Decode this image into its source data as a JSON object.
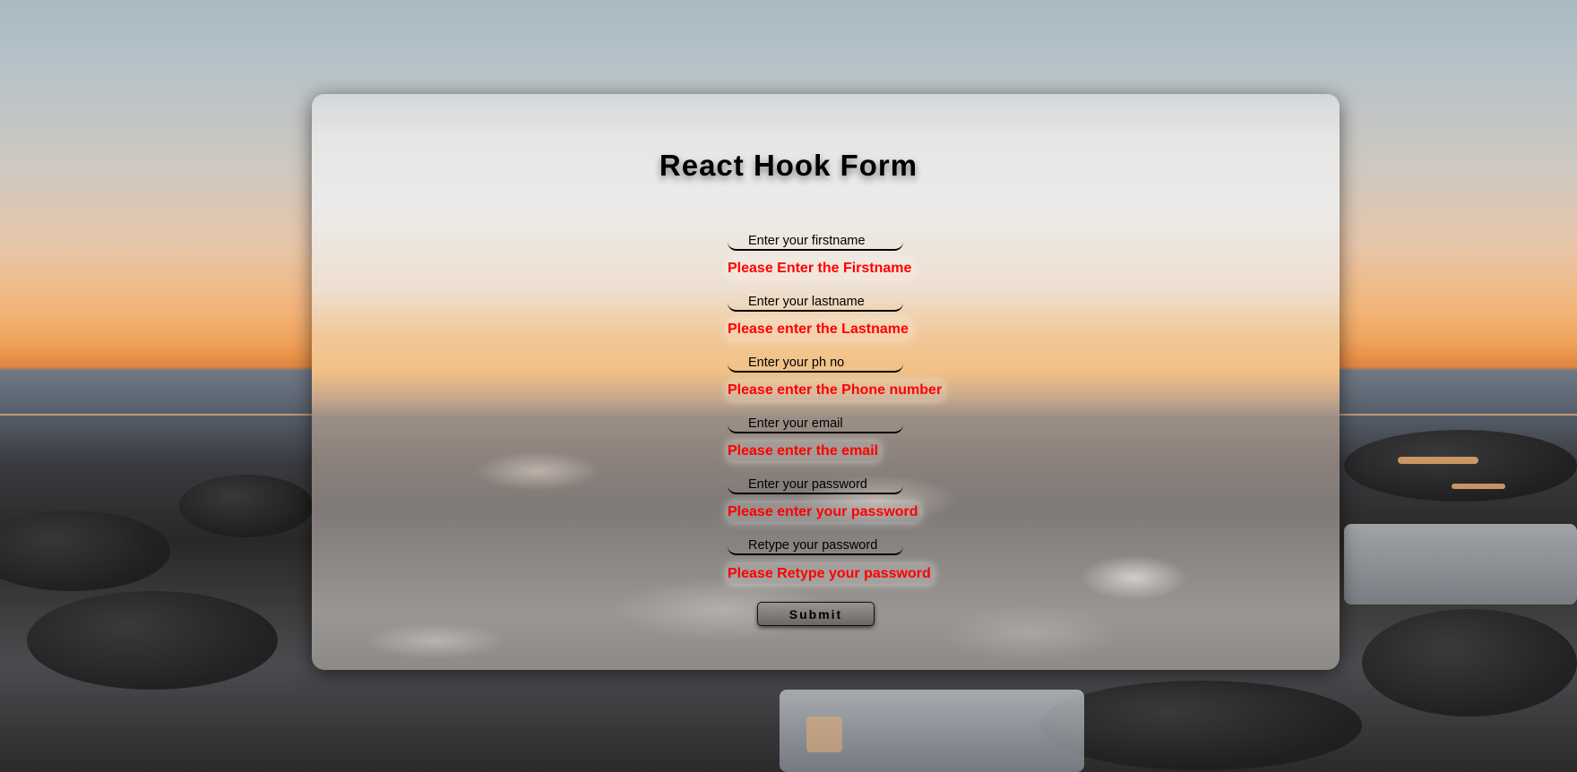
{
  "form": {
    "title": "React Hook Form",
    "fields": [
      {
        "placeholder": "Enter your firstname",
        "error": "Please Enter the Firstname"
      },
      {
        "placeholder": "Enter your lastname",
        "error": "Please enter the Lastname"
      },
      {
        "placeholder": "Enter your ph no",
        "error": "Please enter the Phone number"
      },
      {
        "placeholder": "Enter your email",
        "error": "Please enter the email"
      },
      {
        "placeholder": "Enter your password",
        "error": "Please enter your password"
      },
      {
        "placeholder": "Retype your password",
        "error": "Please Retype your password"
      }
    ],
    "submit_label": "Submit"
  },
  "colors": {
    "error_text": "#ff0000",
    "title_text": "#000000"
  }
}
